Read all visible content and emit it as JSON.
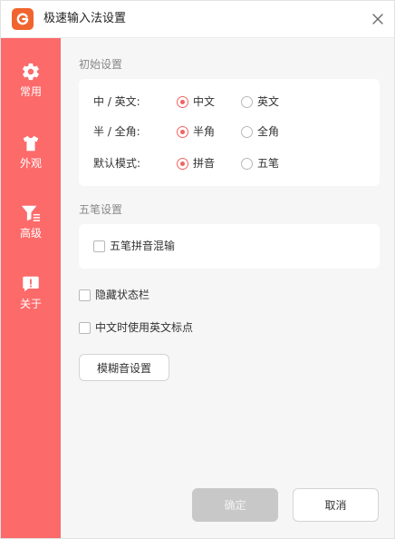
{
  "window": {
    "title": "极速输入法设置",
    "logo_letter": "G"
  },
  "sidebar": {
    "items": [
      {
        "label": "常用",
        "icon": "gear-icon"
      },
      {
        "label": "外观",
        "icon": "tshirt-icon"
      },
      {
        "label": "高级",
        "icon": "filter-icon"
      },
      {
        "label": "关于",
        "icon": "info-bubble-icon"
      }
    ],
    "active_index": 0
  },
  "initial_settings": {
    "title": "初始设置",
    "rows": [
      {
        "label": "中 / 英文:",
        "options": [
          "中文",
          "英文"
        ],
        "selected": 0
      },
      {
        "label": "半 / 全角:",
        "options": [
          "半角",
          "全角"
        ],
        "selected": 0
      },
      {
        "label": "默认模式:",
        "options": [
          "拼音",
          "五笔"
        ],
        "selected": 0
      }
    ]
  },
  "wubi_settings": {
    "title": "五笔设置",
    "mix_label": "五笔拼音混输",
    "mix_checked": false
  },
  "other": {
    "hide_status_bar": "隐藏状态栏",
    "english_punct": "中文时使用英文标点",
    "fuzzy_button": "模糊音设置"
  },
  "footer": {
    "ok_label": "确定",
    "cancel_label": "取消"
  },
  "colors": {
    "accent": "#fc6a6a",
    "logo": "#f0652f"
  }
}
